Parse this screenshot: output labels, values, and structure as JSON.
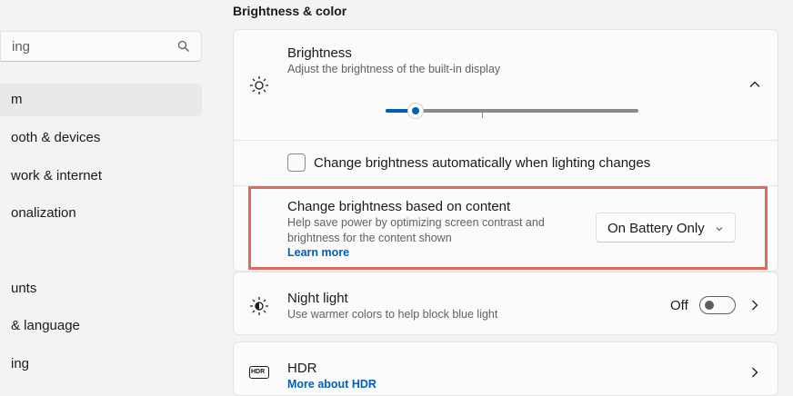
{
  "search": {
    "text": "ing"
  },
  "nav": {
    "items": [
      {
        "label": "m"
      },
      {
        "label": "ooth & devices"
      },
      {
        "label": "work & internet"
      },
      {
        "label": "onalization"
      },
      {
        "label": "unts"
      },
      {
        "label": "& language"
      },
      {
        "label": "ing"
      }
    ],
    "selected_index": 0
  },
  "section": {
    "header": "Brightness & color"
  },
  "brightness": {
    "title": "Brightness",
    "description": "Adjust the brightness of the built-in display",
    "level": 0.12
  },
  "auto_brightness": {
    "label": "Change brightness automatically when lighting changes",
    "checked": false
  },
  "content_brightness": {
    "title": "Change brightness based on content",
    "description_line1": "Help save power by optimizing screen contrast and",
    "description_line2": "brightness for the content shown",
    "link": "Learn more",
    "dropdown_value": "On Battery Only"
  },
  "night_light": {
    "title": "Night light",
    "description": "Use warmer colors to help block blue light",
    "state": "Off"
  },
  "hdr": {
    "title": "HDR",
    "link": "More about HDR",
    "badge": "HDR"
  },
  "colors": {
    "accent": "#005fb8",
    "highlight": "#e06a5d"
  }
}
